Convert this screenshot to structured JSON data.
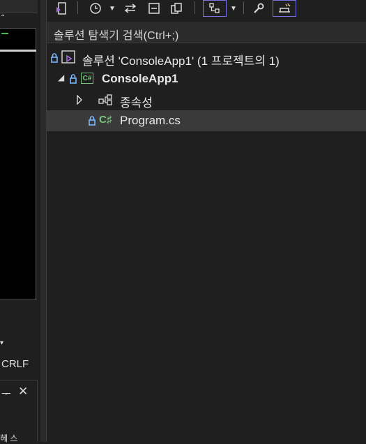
{
  "left_panel": {
    "status_text": "CRLF",
    "pin_glyph": "ᅮ",
    "close_glyph": "✕",
    "bottom_fragment": "헤 스"
  },
  "toolbar": {
    "icons": [
      "vs-solution-icon",
      "history-icon",
      "dropdown-arrow-icon",
      "sync-icon",
      "collapse-all-icon",
      "copy-icon",
      "show-all-files-icon",
      "dropdown-arrow-icon",
      "properties-wrench-icon",
      "preview-icon"
    ]
  },
  "search": {
    "placeholder": "솔루션 탐색기 검색(Ctrl+;)"
  },
  "tree": {
    "solution_label": "솔루션 'ConsoleApp1' (1 프로젝트의 1)",
    "project_label": "ConsoleApp1",
    "dependencies_label": "종속성",
    "file_label": "Program.cs",
    "cs_badge": "C#",
    "cs_symbol": "C♯"
  },
  "colors": {
    "background": "#1f1f1f",
    "selection": "#3a3a3a",
    "accent_active": "#7a74e8",
    "csharp_green": "#7bc47f",
    "lock_blue": "#7ab7ff"
  }
}
